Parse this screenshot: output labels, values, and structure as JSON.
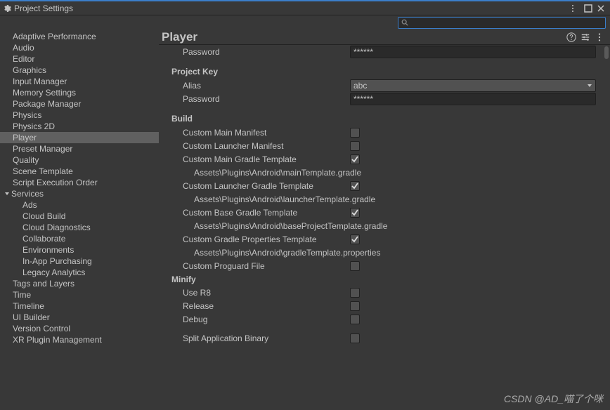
{
  "window": {
    "title": "Project Settings"
  },
  "search": {
    "placeholder": ""
  },
  "sidebar": {
    "items": [
      {
        "label": "Adaptive Performance"
      },
      {
        "label": "Audio"
      },
      {
        "label": "Editor"
      },
      {
        "label": "Graphics"
      },
      {
        "label": "Input Manager"
      },
      {
        "label": "Memory Settings"
      },
      {
        "label": "Package Manager"
      },
      {
        "label": "Physics"
      },
      {
        "label": "Physics 2D"
      },
      {
        "label": "Player"
      },
      {
        "label": "Preset Manager"
      },
      {
        "label": "Quality"
      },
      {
        "label": "Scene Template"
      },
      {
        "label": "Script Execution Order"
      },
      {
        "label": "Services"
      },
      {
        "label": "Ads"
      },
      {
        "label": "Cloud Build"
      },
      {
        "label": "Cloud Diagnostics"
      },
      {
        "label": "Collaborate"
      },
      {
        "label": "Environments"
      },
      {
        "label": "In-App Purchasing"
      },
      {
        "label": "Legacy Analytics"
      },
      {
        "label": "Tags and Layers"
      },
      {
        "label": "Time"
      },
      {
        "label": "Timeline"
      },
      {
        "label": "UI Builder"
      },
      {
        "label": "Version Control"
      },
      {
        "label": "XR Plugin Management"
      }
    ]
  },
  "header": {
    "title": "Player"
  },
  "panel": {
    "password_top": {
      "label": "Password",
      "value": "******"
    },
    "section_projectkey": "Project Key",
    "alias": {
      "label": "Alias",
      "value": "abc"
    },
    "password2": {
      "label": "Password",
      "value": "******"
    },
    "section_build": "Build",
    "custom_main_manifest": {
      "label": "Custom Main Manifest",
      "checked": false
    },
    "custom_launcher_manifest": {
      "label": "Custom Launcher Manifest",
      "checked": false
    },
    "custom_main_gradle": {
      "label": "Custom Main Gradle Template",
      "checked": true,
      "path": "Assets\\Plugins\\Android\\mainTemplate.gradle"
    },
    "custom_launcher_gradle": {
      "label": "Custom Launcher Gradle Template",
      "checked": true,
      "path": "Assets\\Plugins\\Android\\launcherTemplate.gradle"
    },
    "custom_base_gradle": {
      "label": "Custom Base Gradle Template",
      "checked": true,
      "path": "Assets\\Plugins\\Android\\baseProjectTemplate.gradle"
    },
    "custom_gradle_props": {
      "label": "Custom Gradle Properties Template",
      "checked": true,
      "path": "Assets\\Plugins\\Android\\gradleTemplate.properties"
    },
    "custom_proguard": {
      "label": "Custom Proguard File",
      "checked": false
    },
    "section_minify": "Minify",
    "use_r8": {
      "label": "Use R8",
      "checked": false
    },
    "release": {
      "label": "Release",
      "checked": false
    },
    "debug": {
      "label": "Debug",
      "checked": false
    },
    "split_binary": {
      "label": "Split Application Binary",
      "checked": false
    }
  },
  "watermark": "CSDN @AD_喵了个咪"
}
